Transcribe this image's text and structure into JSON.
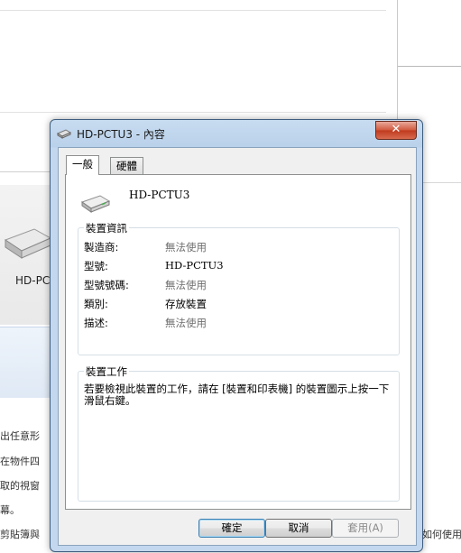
{
  "background": {
    "device_label": "HD-PC",
    "lines": [
      "出任意形",
      "在物件四",
      "取的視窗",
      "幕。",
      "剪貼簿與"
    ],
    "right_text": "如何使用"
  },
  "dialog": {
    "title": "HD-PCTU3 - 內容",
    "close_label": "✕",
    "tabs": [
      {
        "label": "一般"
      },
      {
        "label": "硬體"
      }
    ],
    "device_name": "HD-PCTU3",
    "info_group": {
      "title": "裝置資訊",
      "rows": [
        {
          "label": "製造商:",
          "value": "無法使用"
        },
        {
          "label": "型號:",
          "value": "HD-PCTU3"
        },
        {
          "label": "型號號碼:",
          "value": "無法使用"
        },
        {
          "label": "類別:",
          "value": "存放裝置"
        },
        {
          "label": "描述:",
          "value": "無法使用"
        }
      ]
    },
    "task_group": {
      "title": "裝置工作",
      "text": "若要檢視此裝置的工作，請在 [裝置和印表機] 的裝置圖示上按一下滑鼠右鍵。"
    },
    "buttons": {
      "ok": "確定",
      "cancel": "取消",
      "apply": "套用(A)"
    }
  },
  "colors": {
    "title_bar": "#c8dcf0",
    "close_button": "#c03a1e",
    "muted_value": "#6d6d6d"
  }
}
